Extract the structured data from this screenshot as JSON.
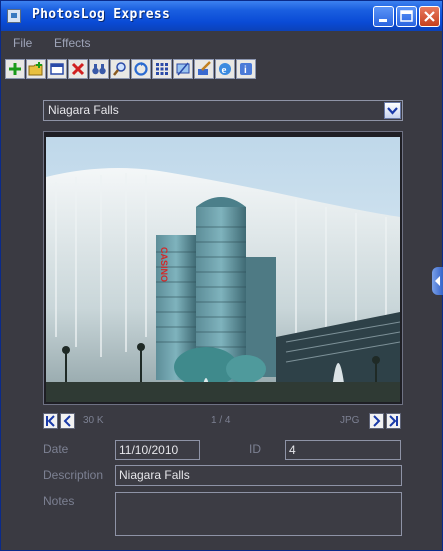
{
  "window": {
    "title": "PhotosLog Express"
  },
  "menu": {
    "file": "File",
    "effects": "Effects"
  },
  "album": {
    "selected": "Niagara Falls"
  },
  "nav": {
    "size": "30 K",
    "position": "1 / 4",
    "format": "JPG"
  },
  "fields": {
    "date_label": "Date",
    "date_value": "11/10/2010",
    "id_label": "ID",
    "id_value": "4",
    "description_label": "Description",
    "description_value": "Niagara Falls",
    "notes_label": "Notes",
    "notes_value": ""
  },
  "photo": {
    "sign_text": "CASINO"
  }
}
